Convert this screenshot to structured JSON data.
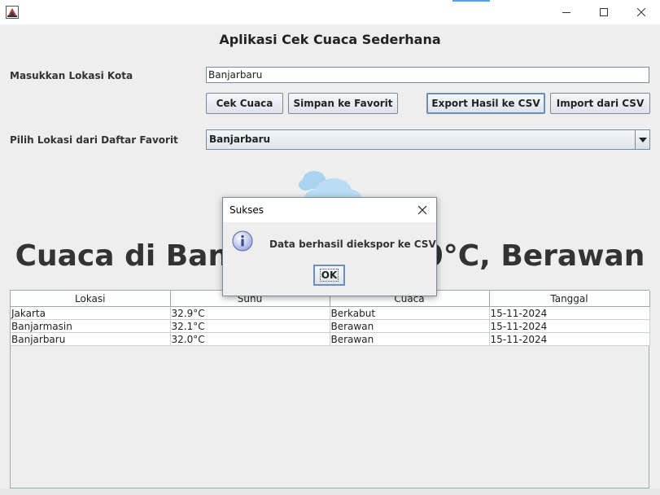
{
  "window": {
    "title": "",
    "controls": {
      "minimize": "minimize-icon",
      "maximize": "maximize-icon",
      "close": "close-icon"
    },
    "accent": "#4fa3e8"
  },
  "app": {
    "title": "Aplikasi Cek Cuaca Sederhana",
    "city_label": "Masukkan Lokasi Kota",
    "city_value": "Banjarbaru",
    "buttons": {
      "check": "Cek Cuaca",
      "save_favorite": "Simpan ke Favorit",
      "export_csv": "Export Hasil ke CSV",
      "import_csv": "Import dari CSV"
    },
    "favorite_label": "Pilih Lokasi dari Daftar Favorit",
    "favorite_selected": "Banjarbaru",
    "weather_icon": "cloud-icon",
    "weather_headline": "Cuaca di Banjarbaru: 32.0°C, Berawan"
  },
  "table": {
    "columns": [
      "Lokasi",
      "Suhu",
      "Cuaca",
      "Tanggal"
    ],
    "rows": [
      [
        "Jakarta",
        "32.9°C",
        "Berkabut",
        "15-11-2024"
      ],
      [
        "Banjarmasin",
        "32.1°C",
        "Berawan",
        "15-11-2024"
      ],
      [
        "Banjarbaru",
        "32.0°C",
        "Berawan",
        "15-11-2024"
      ]
    ]
  },
  "dialog": {
    "title": "Sukses",
    "icon": "info-icon",
    "message": "Data berhasil diekspor ke CSV",
    "ok_label": "OK"
  }
}
